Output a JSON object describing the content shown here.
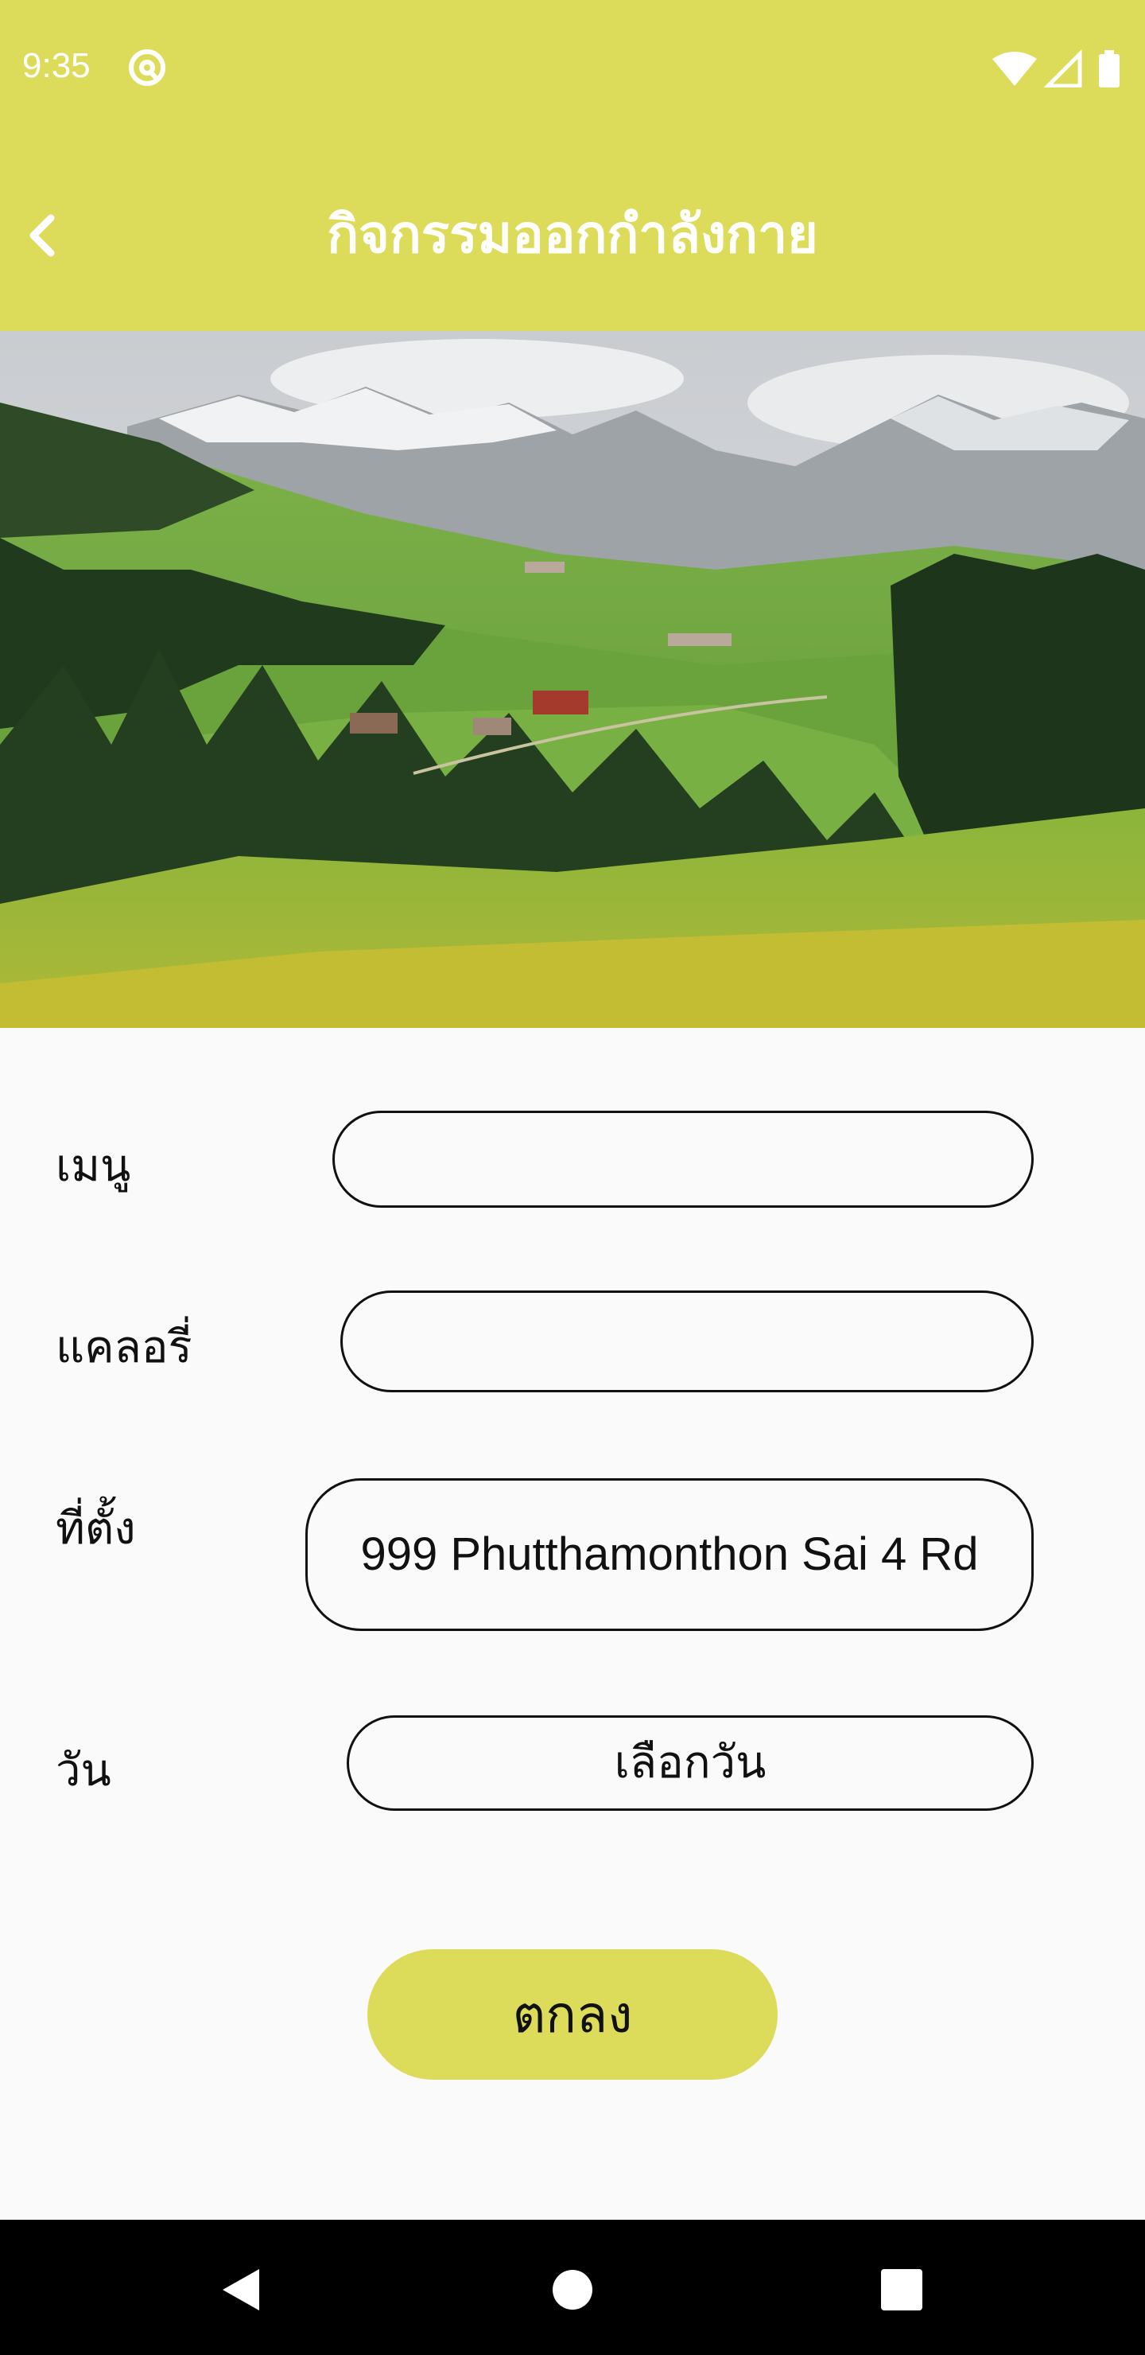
{
  "status_bar": {
    "time": "9:35",
    "icons": [
      "at-sign-icon",
      "wifi-icon",
      "signal-icon",
      "battery-icon"
    ]
  },
  "app_bar": {
    "title": "กิจกรรมออกกำลังกาย",
    "back_icon": "chevron-left-icon",
    "color": "#dcdc5a"
  },
  "hero": {
    "description_icon": "landscape-image"
  },
  "form": {
    "menu_label": "เมนู",
    "menu_value": "",
    "calorie_label": "แคลอรี่",
    "calorie_value": "",
    "location_label": "ที่ตั้ง",
    "location_value": "999 Phutthamonthon Sai 4 Rd",
    "date_label": "วัน",
    "date_value": "เลือกวัน"
  },
  "submit": {
    "label": "ตกลง"
  },
  "nav_bar": {
    "icons": [
      "back-icon",
      "home-icon",
      "recents-icon"
    ]
  }
}
